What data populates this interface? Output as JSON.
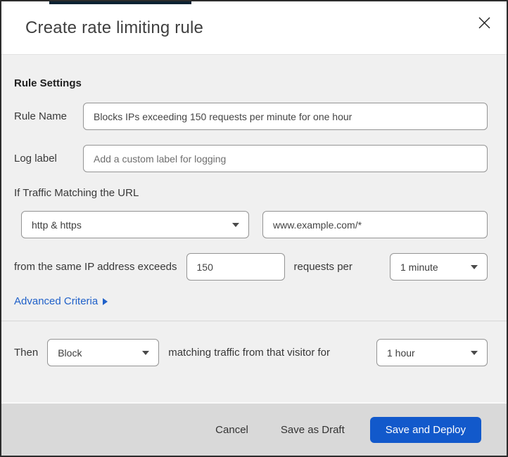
{
  "modal": {
    "title": "Create rate limiting rule"
  },
  "form": {
    "section_heading": "Rule Settings",
    "rule_name": {
      "label": "Rule Name",
      "value": "Blocks IPs exceeding 150 requests per minute for one hour"
    },
    "log_label": {
      "label": "Log label",
      "placeholder": "Add a custom label for logging"
    },
    "traffic_heading": "If Traffic Matching the URL",
    "scheme_select": {
      "value": "http & https"
    },
    "url_input": {
      "value": "www.example.com/*"
    },
    "threshold": {
      "prefix": "from the same IP address exceeds",
      "value": "150",
      "middle": "requests per",
      "period": "1 minute"
    },
    "advanced_link": "Advanced Criteria",
    "then": {
      "label": "Then",
      "action": "Block",
      "middle": "matching traffic from that visitor for",
      "duration": "1 hour"
    }
  },
  "footer": {
    "cancel": "Cancel",
    "save_draft": "Save as Draft",
    "save_deploy": "Save and Deploy"
  },
  "colors": {
    "accent_blue": "#1259cb",
    "link_blue": "#2061c9",
    "body_bg": "#f0f0f0",
    "footer_bg": "#d9d9d9",
    "top_strip": "#0c2233"
  }
}
